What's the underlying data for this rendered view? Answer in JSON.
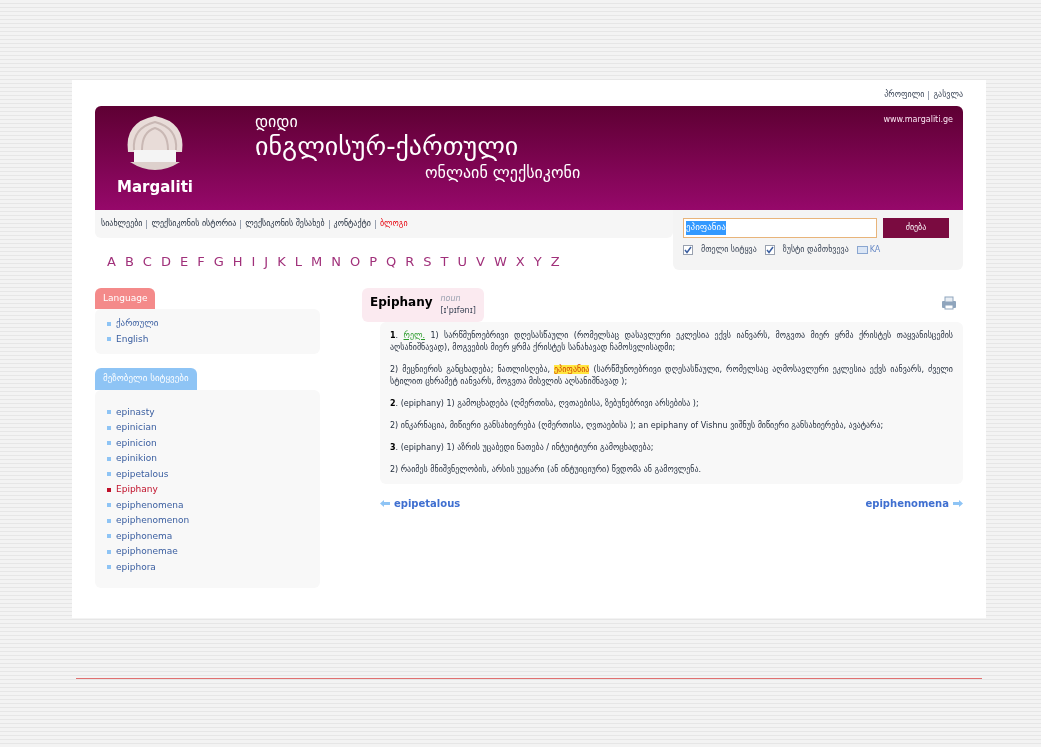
{
  "top_links": [
    "პროფილი",
    "გასვლა"
  ],
  "header": {
    "site_url": "www.margaliti.ge",
    "logo_text": "Margaliti",
    "title_small": "დიდი",
    "title_main": "ინგლისურ-ქართული",
    "title_sub": "ონლაინ ლექსიკონი"
  },
  "nav": [
    {
      "label": "სიახლეები",
      "highlighted": false
    },
    {
      "label": "ლექსიკონის ისტორია",
      "highlighted": false
    },
    {
      "label": "ლექსიკონის შესახებ",
      "highlighted": false
    },
    {
      "label": "კონტაქტი",
      "highlighted": false
    },
    {
      "label": "ბლოგი",
      "highlighted": true
    }
  ],
  "search": {
    "value": "ეპიფანია",
    "button": "ძიება",
    "options": [
      {
        "label": "მთელი სიტყვა",
        "checked": true
      },
      {
        "label": "ზუსტი დამთხვევა",
        "checked": true
      }
    ],
    "keyboard": "KA"
  },
  "alphabet": [
    "A",
    "B",
    "C",
    "D",
    "E",
    "F",
    "G",
    "H",
    "I",
    "J",
    "K",
    "L",
    "M",
    "N",
    "O",
    "P",
    "Q",
    "R",
    "S",
    "T",
    "U",
    "V",
    "W",
    "X",
    "Y",
    "Z"
  ],
  "language_panel": {
    "title": "Language",
    "items": [
      "ქართული",
      "English"
    ]
  },
  "neighbours_panel": {
    "title": "მეზობელი სიტყვები",
    "items": [
      {
        "label": "epinasty",
        "selected": false
      },
      {
        "label": "epinician",
        "selected": false
      },
      {
        "label": "epinicion",
        "selected": false
      },
      {
        "label": "epinikion",
        "selected": false
      },
      {
        "label": "epipetalous",
        "selected": false
      },
      {
        "label": "Epiphany",
        "selected": true
      },
      {
        "label": "epiphenomena",
        "selected": false
      },
      {
        "label": "epiphenomenon",
        "selected": false
      },
      {
        "label": "epiphonema",
        "selected": false
      },
      {
        "label": "epiphonemae",
        "selected": false
      },
      {
        "label": "epiphora",
        "selected": false
      }
    ]
  },
  "entry": {
    "headword": "Epiphany",
    "pos": "noun",
    "transcription": "[ɪ'pɪfənɪ]",
    "paragraphs": [
      [
        {
          "kind": "num",
          "text": "1"
        },
        {
          "kind": "text",
          "text": ". "
        },
        {
          "kind": "label",
          "text": "რელ."
        },
        {
          "kind": "text",
          "text": " 1) სარწმუნოებრივი დღესასწაული (რომელსაც დასავლური ეკლესია ექვს იანვარს, მოგვთა მიერ ყრმა ქრისტეს თაყვანისცემის აღსანიშნავად), მოგვების მიერ ყრმა ქრისტეს სანახავად ჩამოსვლისადმი;"
        }
      ],
      [
        {
          "kind": "text",
          "text": "2) მეცნიერის განცხადება; ნათლისღება, "
        },
        {
          "kind": "highlight",
          "text": "ეპიფანია"
        },
        {
          "kind": "text",
          "text": " (სარწმუნოებრივი დღესასწაული, რომელსაც აღმოსავლური ეკლესია ექვს იანვარს, ძველი სტილით ცხრამეტ იანვარს, მოგვთა მისვლის აღსანიშნავად );"
        }
      ],
      [
        {
          "kind": "num",
          "text": "2"
        },
        {
          "kind": "text",
          "text": ". (epiphany) 1) გამოცხადება (ღმერთისა, ღვთაებისა, ზებუნებრივი არსებისა );"
        }
      ],
      [
        {
          "kind": "text",
          "text": "2) ინკარნაცია, მიწიერი განსახიერება (ღმერთისა, ღვთაებისა ); an epiphany of Vishnu ვიშნუს მიწიერი განსახიერება, ავატარა;"
        }
      ],
      [
        {
          "kind": "num",
          "text": "3"
        },
        {
          "kind": "text",
          "text": ". (epiphany) 1) აზრის უცაბედი ნათება / ინტუიტიური გამოცხადება;"
        }
      ],
      [
        {
          "kind": "text",
          "text": "2) რაიმეს მნიშვნელობის, არსის უეცარი (ან ინტუიციური) წვდომა ან გამოვლენა."
        }
      ]
    ]
  },
  "prev_link": "epipetalous",
  "next_link": "epiphenomena"
}
